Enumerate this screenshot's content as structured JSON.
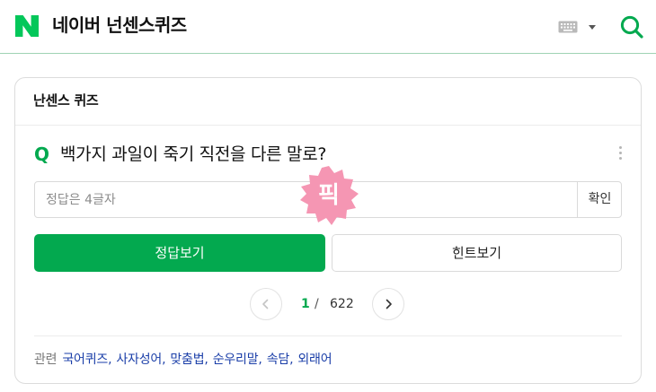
{
  "header": {
    "title": "네이버 넌센스퀴즈",
    "logo": "naver-n-logo",
    "brand_color": "#03a94f",
    "keyboard_icon": "keyboard-icon",
    "search_icon": "search-icon"
  },
  "card": {
    "title": "난센스 퀴즈",
    "q_mark": "Q",
    "question": "백가지 과일이 죽기 직전을 다른 말로?",
    "more_icon": "vertical-dots-icon",
    "answer_placeholder": "정답은 4글자",
    "answer_value": "",
    "confirm_label": "확인",
    "badge_text": "픽",
    "badge_color": "#f596b3",
    "show_answer_label": "정답보기",
    "show_hint_label": "힌트보기",
    "pager": {
      "current": "1",
      "separator": "/",
      "total": "622",
      "prev_icon": "chevron-left-icon",
      "next_icon": "chevron-right-icon"
    },
    "related": {
      "label": "관련",
      "links": [
        "국어퀴즈",
        "사자성어",
        "맞춤법",
        "순우리말",
        "속담",
        "외래어"
      ],
      "separator": ","
    }
  }
}
